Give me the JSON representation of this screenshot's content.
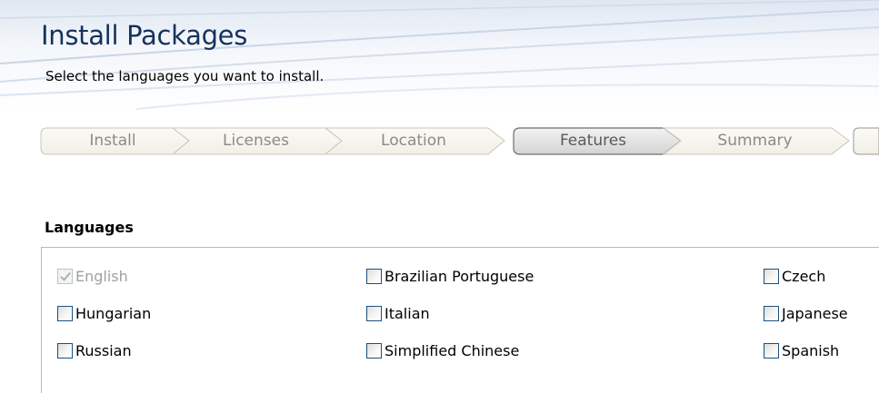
{
  "header": {
    "title": "Install Packages",
    "subtitle": "Select the languages you want to install."
  },
  "steps": [
    {
      "label": "Install",
      "active": false
    },
    {
      "label": "Licenses",
      "active": false
    },
    {
      "label": "Location",
      "active": false
    },
    {
      "label": "Features",
      "active": true
    },
    {
      "label": "Summary",
      "active": false
    },
    {
      "label": "",
      "active": false
    }
  ],
  "languages": {
    "title": "Languages",
    "items": [
      {
        "label": "English",
        "checked": true,
        "disabled": true
      },
      {
        "label": "Brazilian Portuguese",
        "checked": false,
        "disabled": false
      },
      {
        "label": "Czech",
        "checked": false,
        "disabled": false
      },
      {
        "label": "Hungarian",
        "checked": false,
        "disabled": false
      },
      {
        "label": "Italian",
        "checked": false,
        "disabled": false
      },
      {
        "label": "Japanese",
        "checked": false,
        "disabled": false
      },
      {
        "label": "Russian",
        "checked": false,
        "disabled": false
      },
      {
        "label": "Simplified Chinese",
        "checked": false,
        "disabled": false
      },
      {
        "label": "Spanish",
        "checked": false,
        "disabled": false
      }
    ]
  },
  "colors": {
    "title": "#16325c",
    "group_border": "#a7bcd4",
    "checkbox_border": "#1c5180"
  }
}
